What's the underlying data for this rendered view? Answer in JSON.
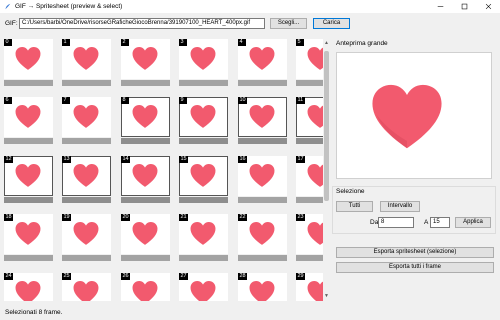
{
  "window": {
    "title": "GIF → Spritesheet (preview & select)",
    "minimize_icon": "minimize-icon",
    "maximize_icon": "maximize-icon",
    "close_icon": "close-icon"
  },
  "file_row": {
    "label": "GIF:",
    "path_value": "C:/Users/barbi/OneDrive/risorseGRaficheGiocoBrenna/391907100_HEART_400px.gif",
    "browse_label": "Scegli...",
    "load_label": "Carica"
  },
  "frames": [
    {
      "index": "0",
      "selected": false
    },
    {
      "index": "1",
      "selected": false
    },
    {
      "index": "2",
      "selected": false
    },
    {
      "index": "3",
      "selected": false
    },
    {
      "index": "4",
      "selected": false
    },
    {
      "index": "5",
      "selected": false
    },
    {
      "index": "6",
      "selected": false
    },
    {
      "index": "7",
      "selected": false
    },
    {
      "index": "8",
      "selected": true
    },
    {
      "index": "9",
      "selected": true
    },
    {
      "index": "10",
      "selected": true
    },
    {
      "index": "11",
      "selected": true
    },
    {
      "index": "12",
      "selected": true
    },
    {
      "index": "13",
      "selected": true
    },
    {
      "index": "14",
      "selected": true
    },
    {
      "index": "15",
      "selected": true
    },
    {
      "index": "16",
      "selected": false
    },
    {
      "index": "17",
      "selected": false
    },
    {
      "index": "18",
      "selected": false
    },
    {
      "index": "19",
      "selected": false
    },
    {
      "index": "20",
      "selected": false
    },
    {
      "index": "21",
      "selected": false
    },
    {
      "index": "22",
      "selected": false
    },
    {
      "index": "23",
      "selected": false
    },
    {
      "index": "24",
      "selected": false
    },
    {
      "index": "25",
      "selected": false
    },
    {
      "index": "26",
      "selected": false
    },
    {
      "index": "27",
      "selected": false
    },
    {
      "index": "28",
      "selected": false
    },
    {
      "index": "29",
      "selected": false
    }
  ],
  "preview": {
    "title": "Anteprima grande"
  },
  "selection": {
    "title": "Selezione",
    "all_label": "Tutti",
    "range_label": "Intervallo",
    "from_label": "Da",
    "from_value": "8",
    "to_label": "A",
    "to_value": "15",
    "apply_label": "Applica"
  },
  "export": {
    "export_selection_label": "Esporta spritesheet (selezione)",
    "export_all_label": "Esporta tutti i frame"
  },
  "status": {
    "text": "Selezionati 8 frame."
  },
  "colors": {
    "heart": "#f25a6e",
    "heart_shade": "#d9475c",
    "selected_border": "#555555"
  }
}
